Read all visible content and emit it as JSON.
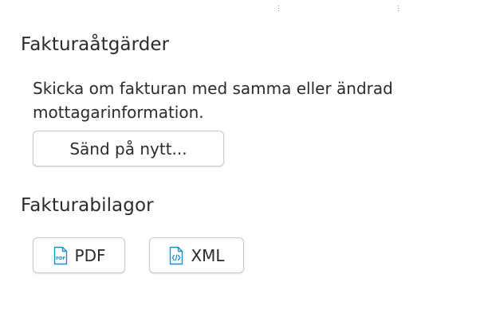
{
  "actions": {
    "title": "Fakturaåtgärder",
    "description": "Skicka om fakturan med samma eller ändrad mottagarinformation.",
    "resend_label": "Sänd på nytt..."
  },
  "attachments": {
    "title": "Fakturabilagor",
    "pdf_label": "PDF",
    "xml_label": "XML",
    "pdf_icon": "pdf-file-icon",
    "xml_icon": "code-file-icon"
  },
  "colors": {
    "icon_accent": "#1e8fc6",
    "text": "#2b2b2b",
    "button_border": "#c9c9c9"
  }
}
